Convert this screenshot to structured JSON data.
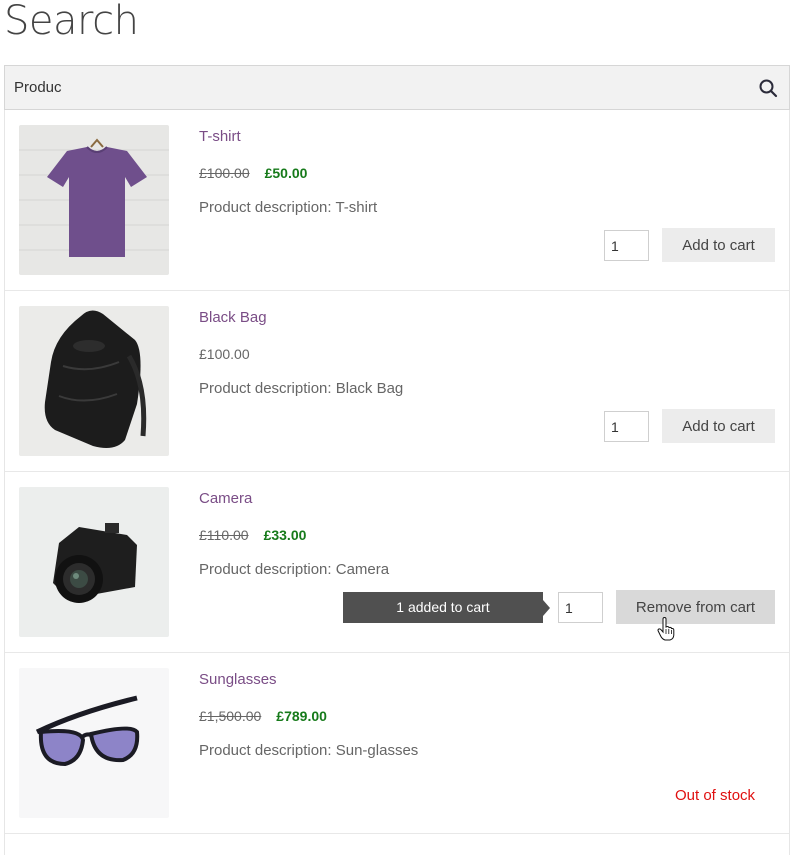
{
  "page": {
    "title": "Search"
  },
  "search": {
    "value": "Produc",
    "icon": "search-icon"
  },
  "products": [
    {
      "name": "T-shirt",
      "old_price": "£100.00",
      "new_price": "£50.00",
      "description": "Product description: T-shirt",
      "qty": "1",
      "button": "Add to cart"
    },
    {
      "name": "Black Bag",
      "price": "£100.00",
      "description": "Product description: Black Bag",
      "qty": "1",
      "button": "Add to cart"
    },
    {
      "name": "Camera",
      "old_price": "£110.00",
      "new_price": "£33.00",
      "description": "Product description: Camera",
      "qty": "1",
      "button": "Remove from cart",
      "notice": "1 added to cart"
    },
    {
      "name": "Sunglasses",
      "old_price": "£1,500.00",
      "new_price": "£789.00",
      "description": "Product description: Sun-glasses",
      "status": "Out of stock"
    }
  ],
  "colors": {
    "title_link": "#7a4d86",
    "sale_price": "#167a1a",
    "out_of_stock": "#e01010",
    "tooltip_bg": "#505050"
  }
}
